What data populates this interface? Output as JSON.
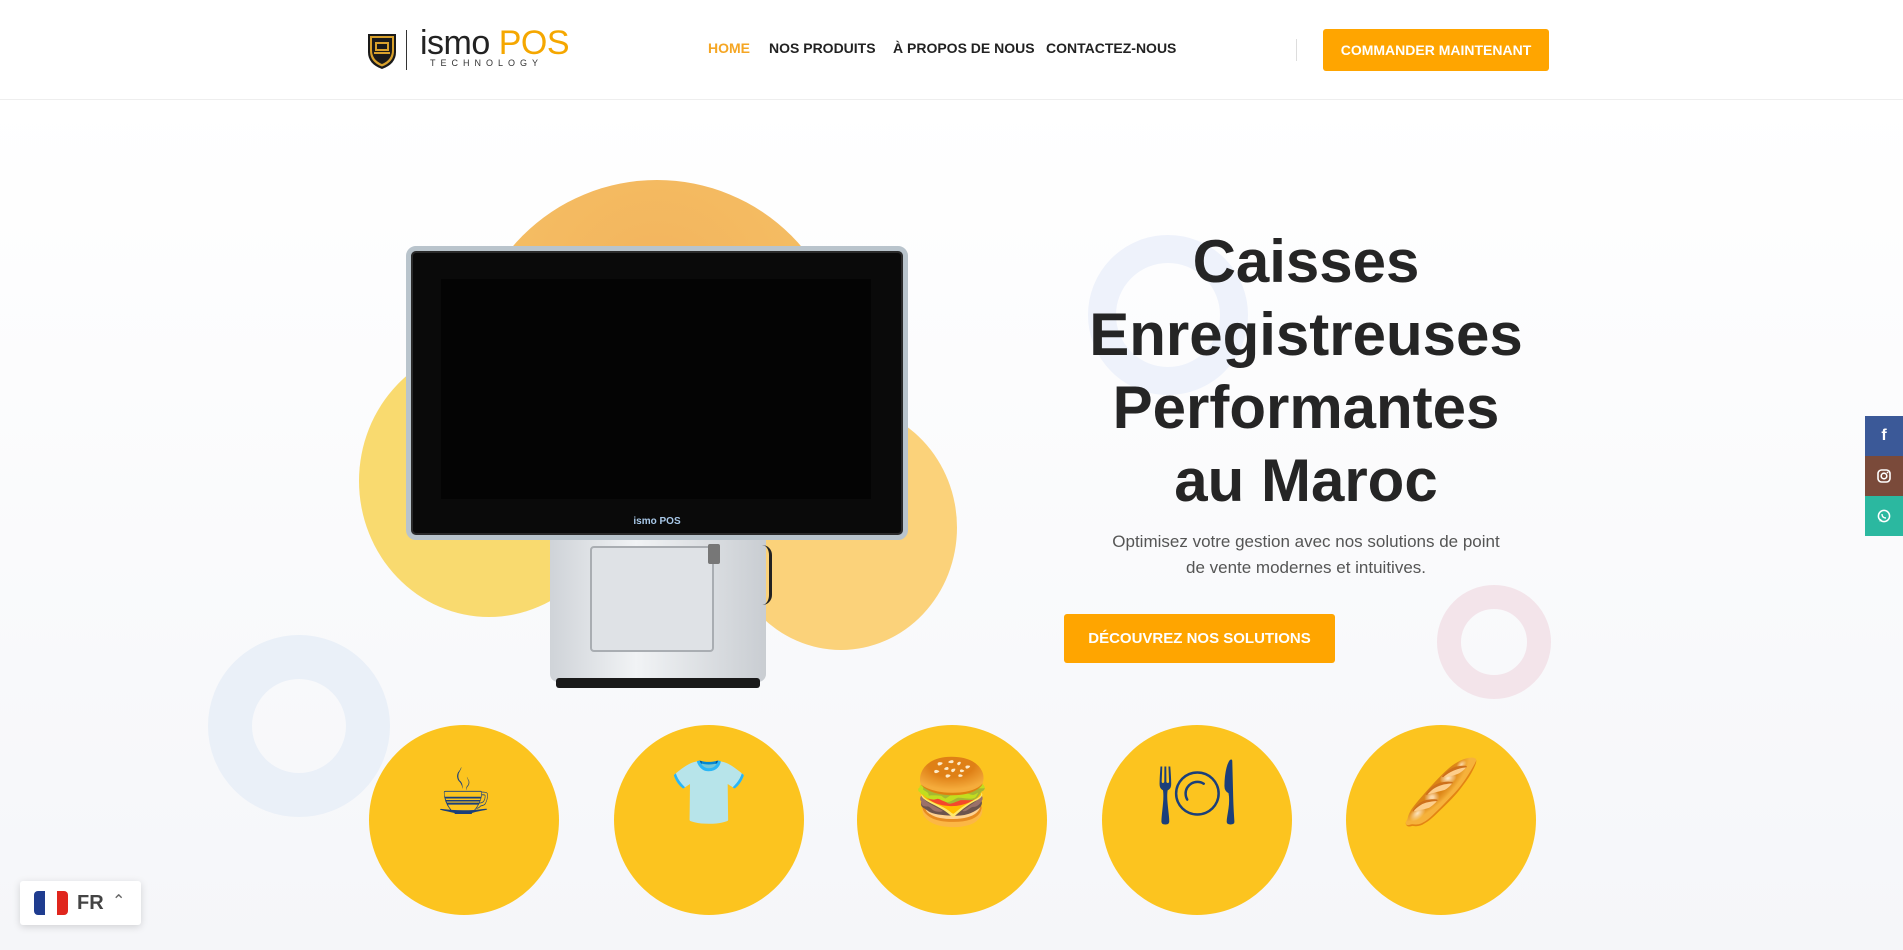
{
  "header": {
    "logo": {
      "brand_main": "ismo",
      "brand_accent": "POS",
      "tagline": "TECHNOLOGY"
    },
    "nav": [
      {
        "label": "HOME",
        "active": true
      },
      {
        "label": "NOS PRODUITS",
        "active": false
      },
      {
        "label": "À PROPOS DE NOUS",
        "active": false
      },
      {
        "label": "CONTACTEZ-NOUS",
        "active": false
      }
    ],
    "cta_label": "COMMANDER MAINTENANT"
  },
  "hero": {
    "title_lines": [
      "Caisses",
      "Enregistreuses",
      "Performantes",
      "au Maroc"
    ],
    "subtitle": "Optimisez votre gestion avec nos solutions de point de vente modernes et intuitives.",
    "cta_label": "DÉCOUVREZ NOS SOLUTIONS",
    "device_brand": "ismo POS"
  },
  "categories": [
    {
      "icon": "coffee-cup-icon"
    },
    {
      "icon": "tshirt-icon"
    },
    {
      "icon": "burger-icon"
    },
    {
      "icon": "plate-dish-icon"
    },
    {
      "icon": "bread-bakery-icon"
    }
  ],
  "social": [
    {
      "icon": "facebook-icon",
      "color": "#3b5998"
    },
    {
      "icon": "instagram-icon",
      "color": "#7a4a3a"
    },
    {
      "icon": "whatsapp-icon",
      "color": "#2bb8a0"
    }
  ],
  "language": {
    "code": "FR",
    "flag_icon": "france-flag-icon"
  },
  "colors": {
    "accent": "#ffa500",
    "nav_active": "#f5a623",
    "category_bg": "#fcc41f"
  }
}
